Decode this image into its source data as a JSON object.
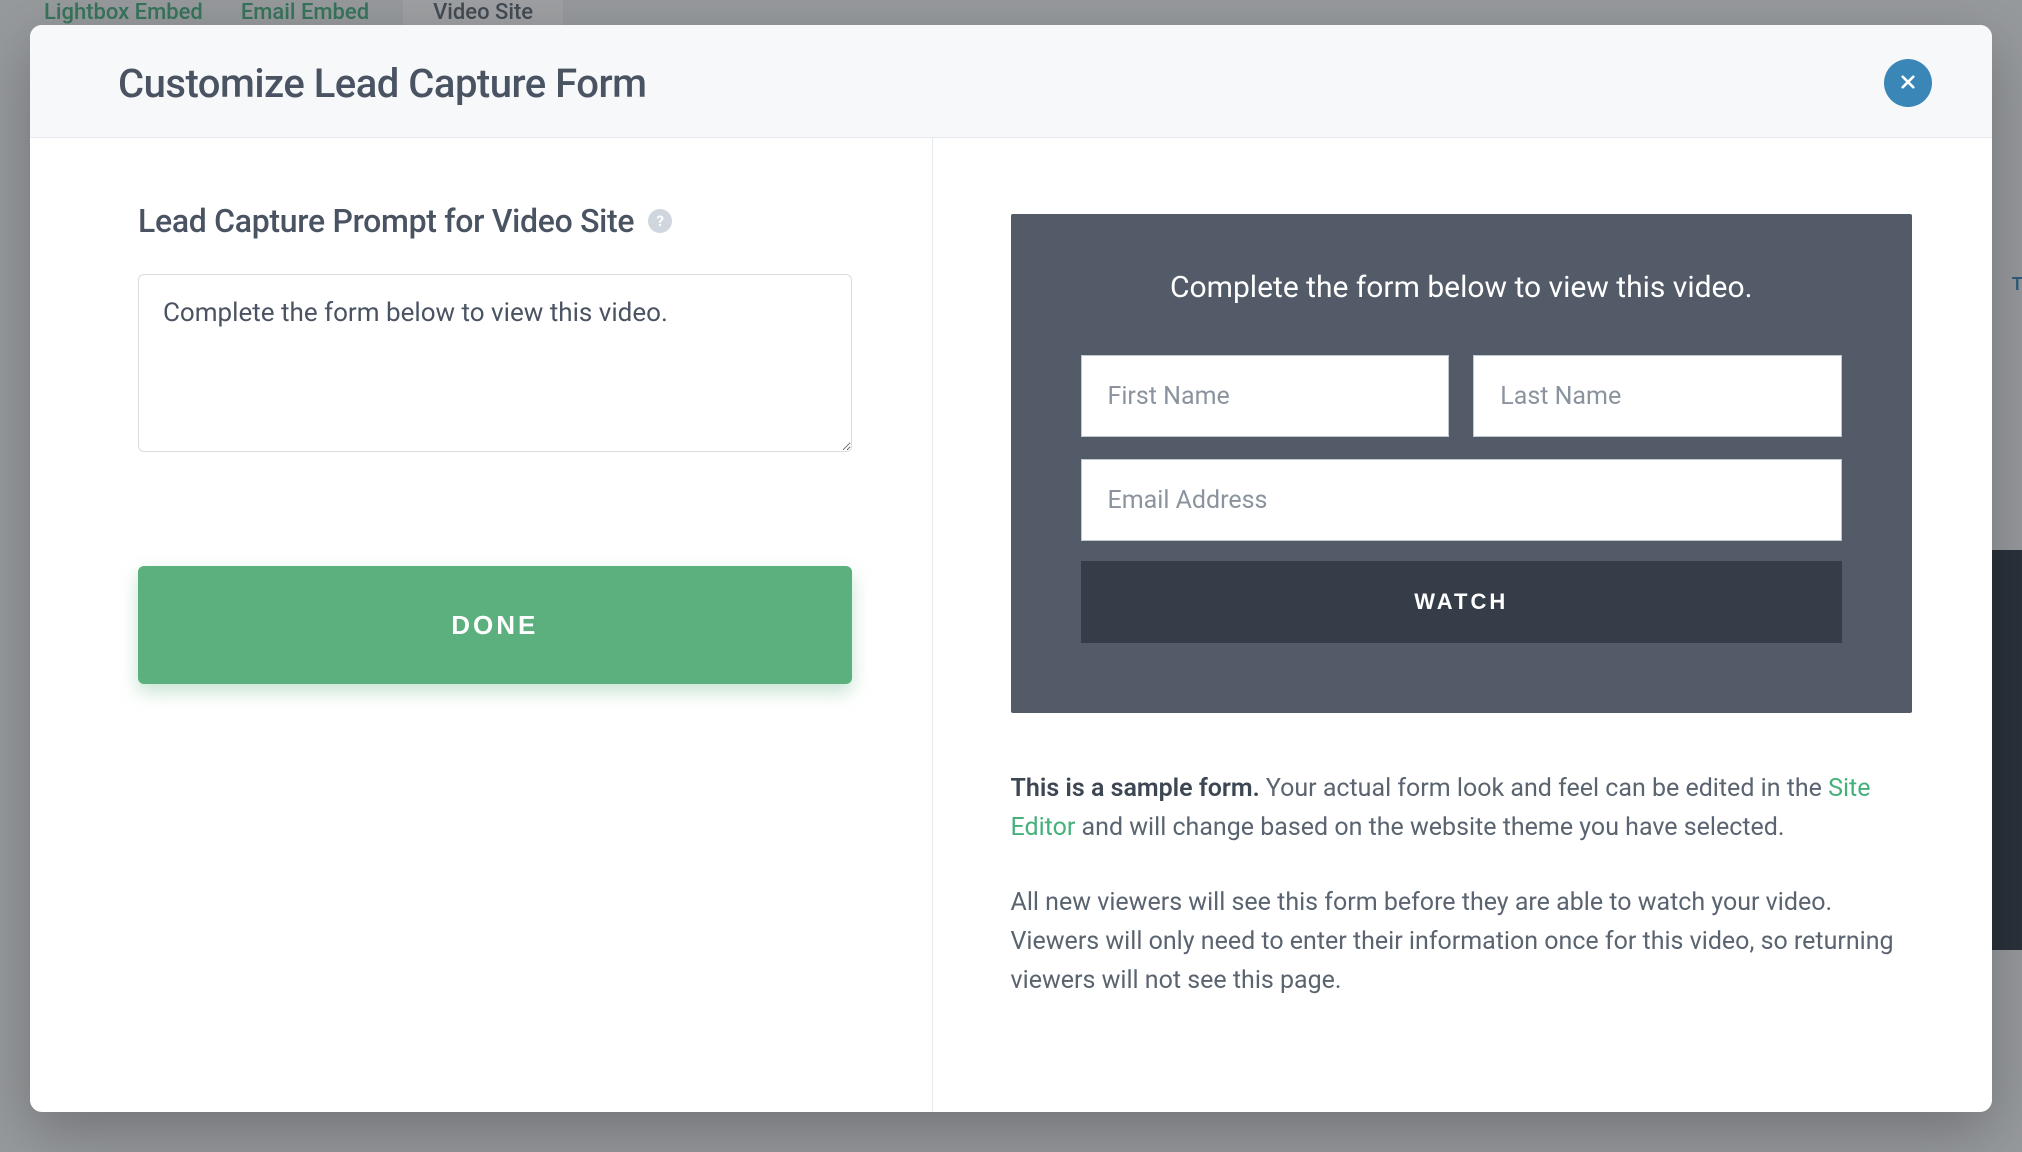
{
  "background": {
    "tabs": {
      "lightbox": "Lightbox Embed",
      "email": "Email Embed",
      "videosite": "Video Site"
    },
    "right_label": "TI"
  },
  "modal": {
    "title": "Customize Lead Capture Form",
    "section_label": "Lead Capture Prompt for Video Site",
    "help_glyph": "?",
    "prompt_value": "Complete the form below to view this video.",
    "done_label": "DONE"
  },
  "preview": {
    "heading": "Complete the form below to view this video.",
    "first_name_placeholder": "First Name",
    "last_name_placeholder": "Last Name",
    "email_placeholder": "Email Address",
    "watch_label": "WATCH"
  },
  "help": {
    "strong": "This is a sample form.",
    "line1_rest": " Your actual form look and feel can be edited in the ",
    "site_editor_link": "Site Editor",
    "line1_tail": " and will change based on the website theme you have selected.",
    "line2": "All new viewers will see this form before they are able to watch your video. Viewers will only need to enter their information once for this video, so returning viewers will not see this page."
  }
}
